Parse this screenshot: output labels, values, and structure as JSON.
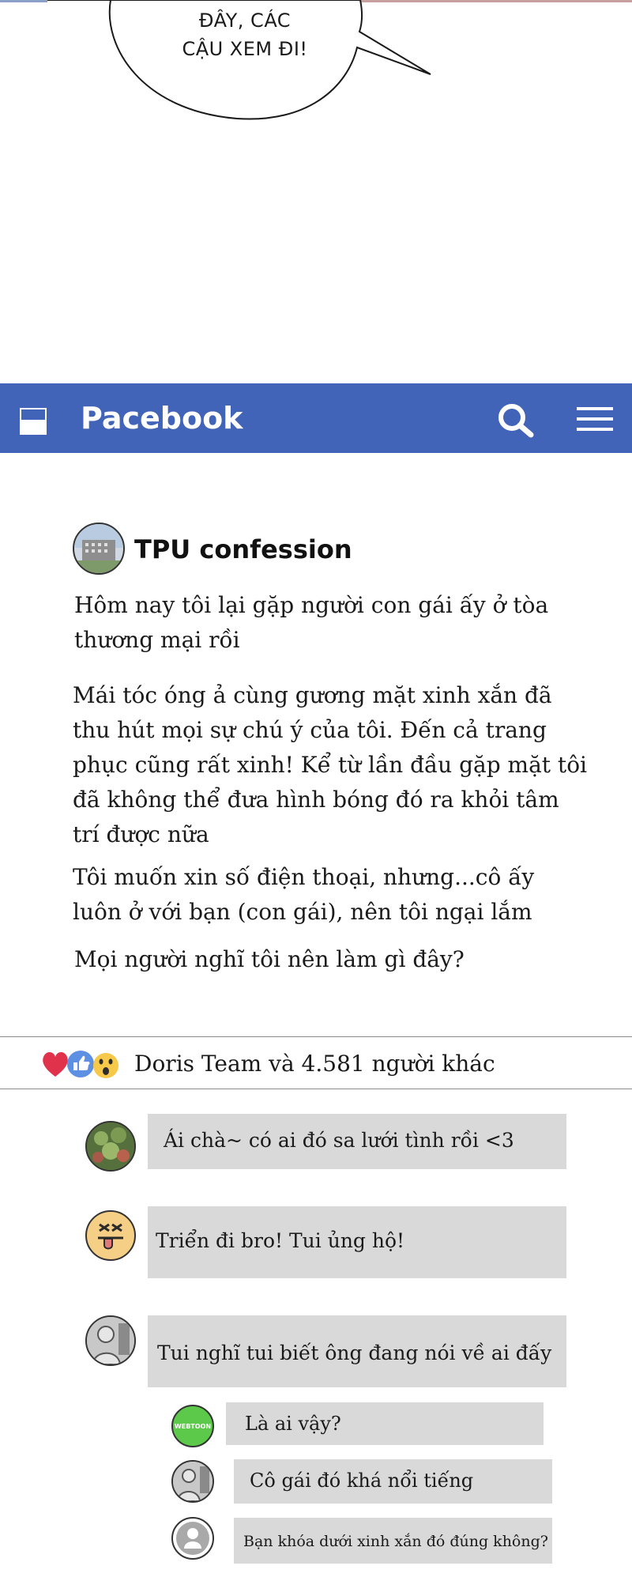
{
  "comic": {
    "speech_bubble": [
      "ĐÂY, CÁC",
      "CẬU XEM ĐI!"
    ]
  },
  "app": {
    "title": "Pacebook",
    "icons": [
      "app-logo-icon",
      "search-icon",
      "menu-icon"
    ],
    "colors": {
      "header": "#4264b8",
      "comment_bg": "#d9d9d9"
    }
  },
  "post": {
    "author": "TPU confession",
    "paragraphs": [
      [
        "Hôm nay tôi lại gặp người con gái ấy ở tòa",
        "thương mại rồi"
      ],
      [
        "Mái tóc óng ả cùng gương mặt xinh xắn đã",
        "thu hút mọi sự chú ý của tôi. Đến cả trang",
        "phục cũng rất xinh! Kể từ lần đầu gặp mặt tôi",
        "đã không thể đưa hình bóng đó ra khỏi tâm",
        "trí được nữa"
      ],
      [
        "Tôi muốn xin số điện thoại, nhưng...cô ấy",
        "luôn ở với bạn (con gái), nên tôi ngại lắm"
      ],
      [
        "Mọi người nghĩ tôi nên làm gì đây?"
      ]
    ],
    "reactions": {
      "text": "Doris Team và 4.581 người khác",
      "icons": [
        "heart-reaction-icon",
        "like-reaction-icon",
        "wow-reaction-icon"
      ]
    }
  },
  "comments": [
    {
      "text": "Ái chà~ có ai đó sa lưới tình rồi <3",
      "avatar": "plant-avatar"
    },
    {
      "text": "Triển đi bro! Tui ủng hộ!",
      "avatar": "tongue-face-avatar"
    },
    {
      "text": "Tui nghĩ tui biết ông đang nói về ai đấy",
      "avatar": "person-avatar"
    },
    {
      "text": "Là ai vậy?",
      "avatar": "webtoon-avatar",
      "avatar_label": "WEBTOON"
    },
    {
      "text": "Cô gái đó khá nổi tiếng",
      "avatar": "person-avatar"
    },
    {
      "text": "Bạn khóa dưới xinh xắn đó đúng không?",
      "avatar": "default-user-avatar"
    }
  ]
}
